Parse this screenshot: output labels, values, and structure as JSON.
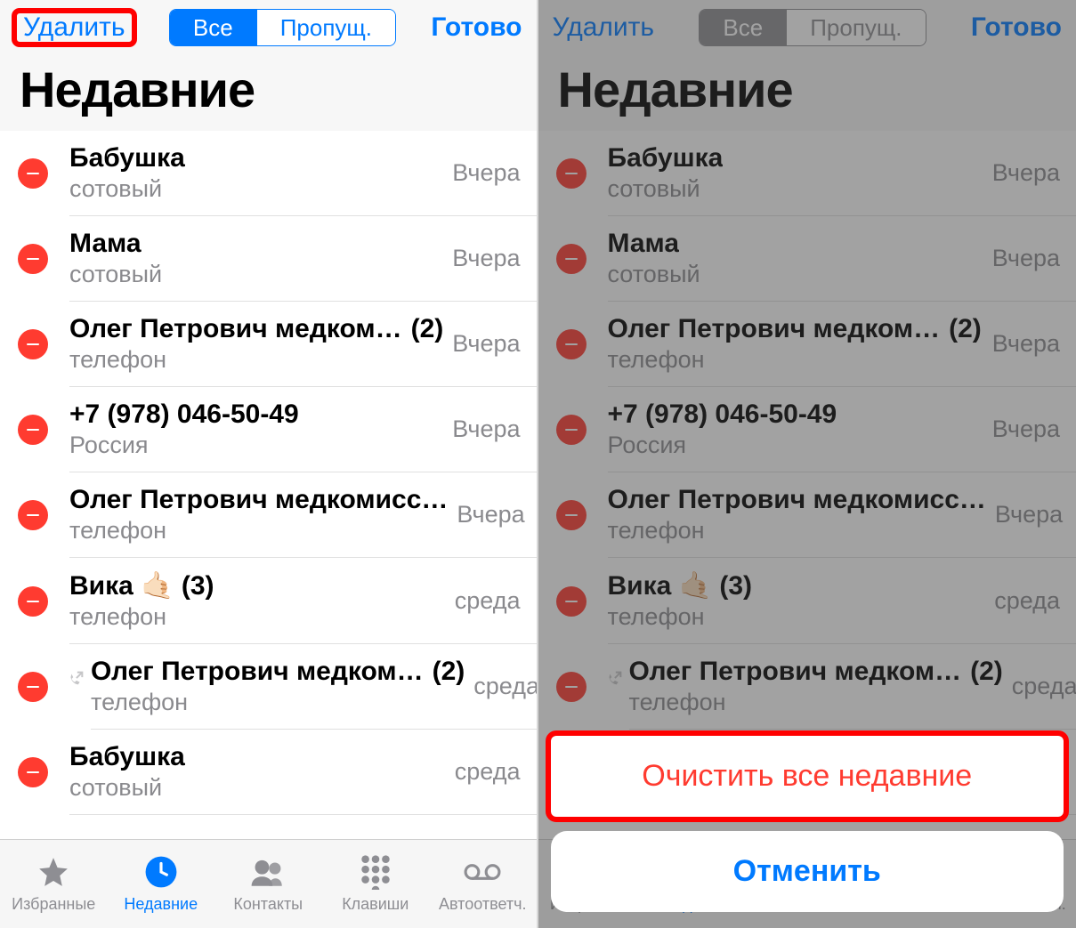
{
  "header": {
    "delete": "Удалить",
    "done": "Готово",
    "seg_all": "Все",
    "seg_missed": "Пропущ.",
    "title": "Недавние"
  },
  "calls": [
    {
      "name": "Бабушка",
      "sub": "сотовый",
      "time": "Вчера",
      "count": "",
      "outgoing": false
    },
    {
      "name": "Мама",
      "sub": "сотовый",
      "time": "Вчера",
      "count": "",
      "outgoing": false
    },
    {
      "name": "Олег Петрович медком…",
      "sub": "телефон",
      "time": "Вчера",
      "count": "(2)",
      "outgoing": false
    },
    {
      "name": "+7 (978) 046-50-49",
      "sub": "Россия",
      "time": "Вчера",
      "count": "",
      "outgoing": false
    },
    {
      "name": "Олег Петрович медкомисс…",
      "sub": "телефон",
      "time": "Вчера",
      "count": "",
      "outgoing": false
    },
    {
      "name": "Вика 🤙🏻 (3)",
      "sub": "телефон",
      "time": "среда",
      "count": "",
      "outgoing": false
    },
    {
      "name": "Олег Петрович медком…",
      "sub": "телефон",
      "time": "среда",
      "count": "(2)",
      "outgoing": true
    },
    {
      "name": "Бабушка",
      "sub": "сотовый",
      "time": "среда",
      "count": "",
      "outgoing": false
    }
  ],
  "tabs": {
    "favorites": "Избранные",
    "recents": "Недавние",
    "contacts": "Контакты",
    "keypad": "Клавиши",
    "voicemail": "Автоответч."
  },
  "sheet": {
    "clear": "Очистить все недавние",
    "cancel": "Отменить"
  }
}
